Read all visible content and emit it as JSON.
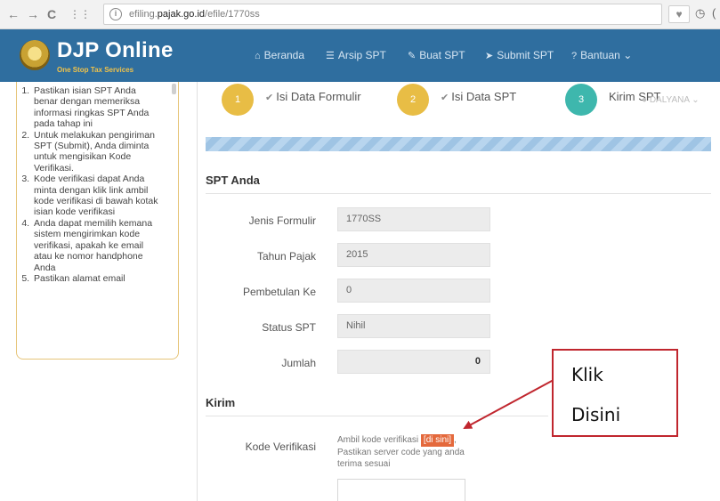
{
  "browser": {
    "url_prefix": "efiling.",
    "url_host": "pajak.go.id",
    "url_path": "/efile/1770ss"
  },
  "header": {
    "title": "DJP Online",
    "subtitle": "One Stop Tax Services",
    "menu": [
      {
        "label": "Beranda",
        "icon": "home-icon"
      },
      {
        "label": "Arsip SPT",
        "icon": "list-icon"
      },
      {
        "label": "Buat SPT",
        "icon": "edit-icon"
      },
      {
        "label": "Submit SPT",
        "icon": "send-icon"
      },
      {
        "label": "Bantuan",
        "icon": "question-icon"
      }
    ]
  },
  "sidebar": {
    "items": [
      "Pastikan isian SPT Anda benar dengan memeriksa informasi ringkas SPT Anda pada tahap ini",
      "Untuk melakukan pengiriman SPT (Submit), Anda diminta untuk mengisikan Kode Verifikasi.",
      "Kode verifikasi dapat Anda minta dengan klik link ambil kode verifikasi di bawah kotak isian kode verifikasi",
      "Anda dapat memilih kemana sistem mengirimkan kode verifikasi, apakah ke email atau ke nomor handphone Anda",
      "Pastikan alamat email"
    ]
  },
  "steps": [
    {
      "number": "1",
      "label": "Isi Data Formulir",
      "color": "#e8bd45"
    },
    {
      "number": "2",
      "label": "Isi Data SPT",
      "color": "#e8bd45"
    },
    {
      "number": "3",
      "label": "Kirim SPT",
      "color": "#3eb7ad"
    }
  ],
  "user_overlay": "DALYANA",
  "spt": {
    "section_title": "SPT Anda",
    "fields": [
      {
        "label": "Jenis Formulir",
        "value": "1770SS"
      },
      {
        "label": "Tahun Pajak",
        "value": "2015"
      },
      {
        "label": "Pembetulan Ke",
        "value": "0"
      },
      {
        "label": "Status SPT",
        "value": "Nihil"
      },
      {
        "label": "Jumlah",
        "value": "0"
      }
    ]
  },
  "kirim": {
    "section_title": "Kirim",
    "label": "Kode Verifikasi",
    "text_before": "Ambil kode verifikasi ",
    "link_label": "[di sini]",
    "text_after": ", Pastikan server code yang anda terima sesuai",
    "input_value": ""
  },
  "callout": {
    "line1": "Klik",
    "line2": "Disini",
    "color": "#c0262e"
  }
}
